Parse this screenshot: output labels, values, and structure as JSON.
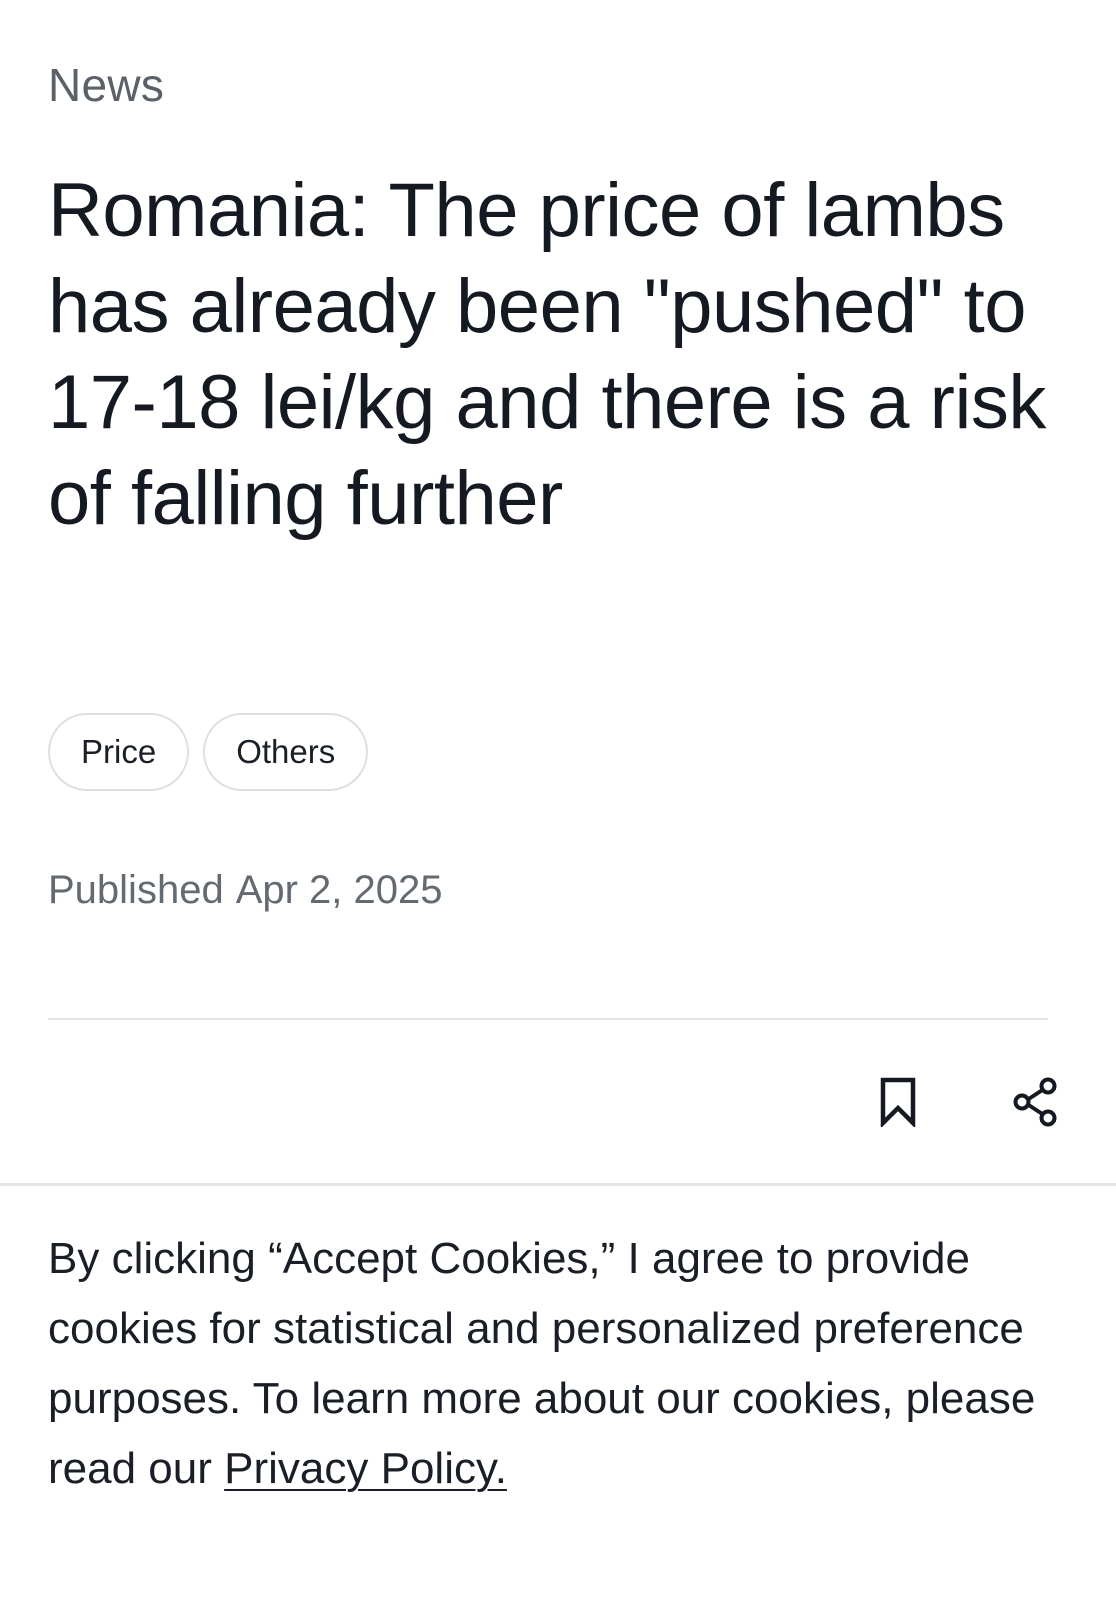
{
  "article": {
    "category": "News",
    "headline": "Romania: The price of lambs has already been \"pushed\" to 17-18 lei/kg and there is a risk of falling further",
    "tags": [
      "Price",
      "Others"
    ],
    "published_label": "Published",
    "published_date": "Apr 2, 2025"
  },
  "actions": {
    "bookmark_icon": "bookmark-icon",
    "share_icon": "share-icon"
  },
  "cookie_banner": {
    "text": "By clicking “Accept Cookies,” I agree to provide cookies for statistical and personalized preference purposes. To learn more about our cookies, please read our",
    "link_label": "Privacy Policy."
  },
  "colors": {
    "text_primary": "#141922",
    "text_secondary": "#5b6169",
    "border": "#dcdfe3",
    "background": "#ffffff"
  }
}
